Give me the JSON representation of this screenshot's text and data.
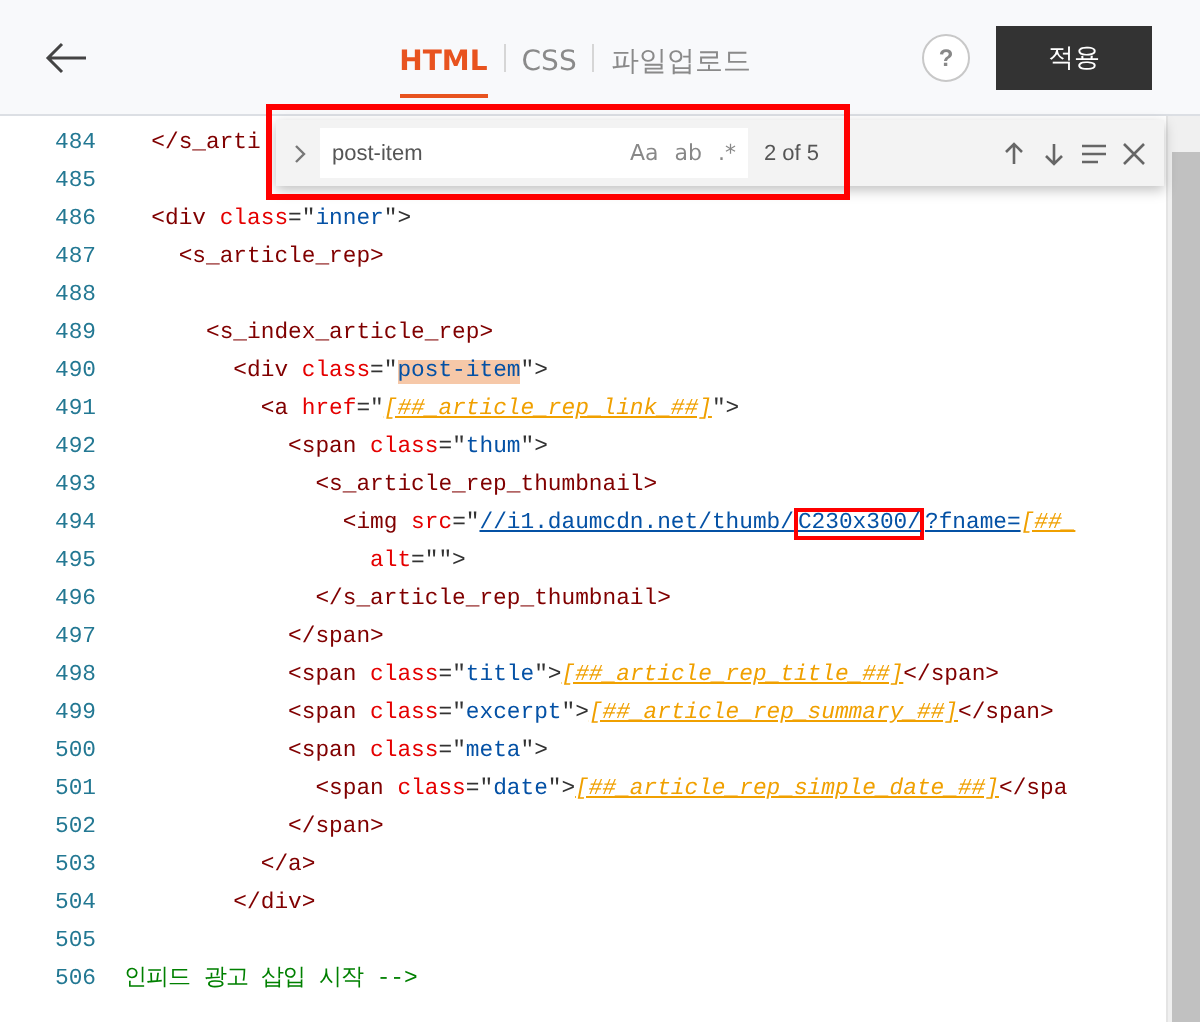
{
  "header": {
    "tabs": [
      {
        "label": "HTML",
        "selected": true
      },
      {
        "label": "CSS",
        "selected": false
      },
      {
        "label": "파일업로드",
        "selected": false
      }
    ],
    "help": "?",
    "apply_button": "적용"
  },
  "find_widget": {
    "value": "post-item",
    "options": [
      "Aa",
      "ab",
      ".*"
    ],
    "count": "2 of 5",
    "annotated": true
  },
  "code_lines": [
    {
      "number": "484",
      "tokens": [
        {
          "kind": "tag",
          "text": "  </s_arti"
        }
      ]
    },
    {
      "number": "485"
    },
    {
      "number": "486",
      "tokens": [
        {
          "kind": "tag",
          "text": "  <div"
        },
        {
          "kind": "attr",
          "text": " class"
        },
        {
          "kind": "punct",
          "text": "=\""
        },
        {
          "kind": "str",
          "text": "inner"
        },
        {
          "kind": "punct",
          "text": "\">"
        }
      ]
    },
    {
      "number": "487",
      "tokens": [
        {
          "kind": "tag",
          "text": "    <s_article_rep>"
        }
      ]
    },
    {
      "number": "488"
    },
    {
      "number": "489",
      "tokens": [
        {
          "kind": "tag",
          "text": "      <s_index_article_rep>"
        }
      ]
    },
    {
      "number": "490",
      "tokens": [
        {
          "kind": "tag",
          "text": "        <div"
        },
        {
          "kind": "attr",
          "text": " class"
        },
        {
          "kind": "punct",
          "text": "=\""
        },
        {
          "kind": "match",
          "text": "post-item"
        },
        {
          "kind": "punct",
          "text": "\">"
        }
      ]
    },
    {
      "number": "491",
      "tokens": [
        {
          "kind": "tag",
          "text": "          <a"
        },
        {
          "kind": "attr",
          "text": " href"
        },
        {
          "kind": "punct",
          "text": "=\""
        },
        {
          "kind": "tmpl",
          "text": "[##_article_rep_link_##]"
        },
        {
          "kind": "punct",
          "text": "\">"
        }
      ]
    },
    {
      "number": "492",
      "tokens": [
        {
          "kind": "tag",
          "text": "            <span"
        },
        {
          "kind": "attr",
          "text": " class"
        },
        {
          "kind": "punct",
          "text": "=\""
        },
        {
          "kind": "str",
          "text": "thum"
        },
        {
          "kind": "punct",
          "text": "\">"
        }
      ]
    },
    {
      "number": "493",
      "tokens": [
        {
          "kind": "tag",
          "text": "              <s_article_rep_thumbnail>"
        }
      ]
    },
    {
      "number": "494",
      "tokens": [
        {
          "kind": "tag",
          "text": "                <img"
        },
        {
          "kind": "attr",
          "text": " src"
        },
        {
          "kind": "punct",
          "text": "=\""
        },
        {
          "kind": "url",
          "text": "//i1.daumcdn.net/thumb/"
        },
        {
          "kind": "urlbox",
          "text": "C230x300/"
        },
        {
          "kind": "url",
          "text": "?fname="
        },
        {
          "kind": "tmpl",
          "text": "[##_"
        }
      ]
    },
    {
      "number": "495",
      "tokens": [
        {
          "kind": "attr",
          "text": "                  alt"
        },
        {
          "kind": "punct",
          "text": "=\"\">"
        }
      ]
    },
    {
      "number": "496",
      "tokens": [
        {
          "kind": "tag",
          "text": "              </s_article_rep_thumbnail>"
        }
      ]
    },
    {
      "number": "497",
      "tokens": [
        {
          "kind": "tag",
          "text": "            </span>"
        }
      ]
    },
    {
      "number": "498",
      "tokens": [
        {
          "kind": "tag",
          "text": "            <span"
        },
        {
          "kind": "attr",
          "text": " class"
        },
        {
          "kind": "punct",
          "text": "=\""
        },
        {
          "kind": "str",
          "text": "title"
        },
        {
          "kind": "punct",
          "text": "\">"
        },
        {
          "kind": "tmpl",
          "text": "[##_article_rep_title_##]"
        },
        {
          "kind": "tag",
          "text": "</span>"
        }
      ]
    },
    {
      "number": "499",
      "tokens": [
        {
          "kind": "tag",
          "text": "            <span"
        },
        {
          "kind": "attr",
          "text": " class"
        },
        {
          "kind": "punct",
          "text": "=\""
        },
        {
          "kind": "str",
          "text": "excerpt"
        },
        {
          "kind": "punct",
          "text": "\">"
        },
        {
          "kind": "tmpl",
          "text": "[##_article_rep_summary_##]"
        },
        {
          "kind": "tag",
          "text": "</span>"
        }
      ]
    },
    {
      "number": "500",
      "tokens": [
        {
          "kind": "tag",
          "text": "            <span"
        },
        {
          "kind": "attr",
          "text": " class"
        },
        {
          "kind": "punct",
          "text": "=\""
        },
        {
          "kind": "str",
          "text": "meta"
        },
        {
          "kind": "punct",
          "text": "\">"
        }
      ]
    },
    {
      "number": "501",
      "tokens": [
        {
          "kind": "tag",
          "text": "              <span"
        },
        {
          "kind": "attr",
          "text": " class"
        },
        {
          "kind": "punct",
          "text": "=\""
        },
        {
          "kind": "str",
          "text": "date"
        },
        {
          "kind": "punct",
          "text": "\">"
        },
        {
          "kind": "tmpl",
          "text": "[##_article_rep_simple_date_##]"
        },
        {
          "kind": "tag",
          "text": "</spa"
        }
      ]
    },
    {
      "number": "502",
      "tokens": [
        {
          "kind": "tag",
          "text": "            </span>"
        }
      ]
    },
    {
      "number": "503",
      "tokens": [
        {
          "kind": "tag",
          "text": "          </a>"
        }
      ]
    },
    {
      "number": "504",
      "tokens": [
        {
          "kind": "tag",
          "text": "        </div>"
        }
      ]
    },
    {
      "number": "505"
    },
    {
      "number": "506",
      "tokens": [
        {
          "kind": "comment",
          "text": "인피드 광고 삽입 시작 -->"
        }
      ]
    }
  ]
}
